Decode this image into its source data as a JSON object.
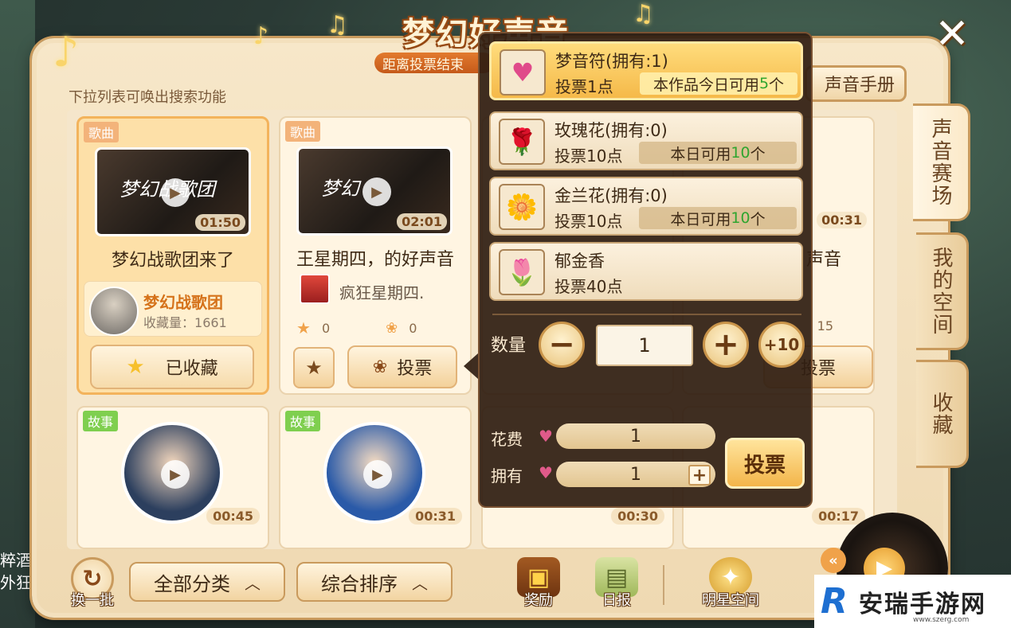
{
  "title": "梦幻好声音",
  "subtitle": "距离投票结束",
  "hint": "下拉列表可唤出搜索功能",
  "handbook_label": "声音手册",
  "close_label": "✕",
  "side_tabs": [
    "声音赛场",
    "我的空间",
    "收藏"
  ],
  "cards": [
    {
      "tag": "歌曲",
      "thumb_title": "梦幻战歌团",
      "thumb_title2": "声音",
      "duration": "01:50",
      "title": "梦幻战歌团来了",
      "author": "梦幻战歌团",
      "fav_label": "收藏量：",
      "fav_count": "1661",
      "collected_label": "已收藏"
    },
    {
      "tag": "歌曲",
      "thumb_title": "梦幻",
      "thumb_title2": "声音",
      "duration": "02:01",
      "title": "王星期四，的好声音",
      "author": "疯狂星期四.",
      "stars": "0",
      "flowers": "0",
      "vote_label": "投票"
    }
  ],
  "hidden_right": {
    "duration": "00:31",
    "title_part": "声音",
    "flowers": "15",
    "vote_label": "投票"
  },
  "story_cards": [
    {
      "tag": "故事",
      "duration": "00:45"
    },
    {
      "tag": "故事",
      "duration": "00:31"
    },
    {
      "tag": "故事",
      "duration": "00:30"
    },
    {
      "tag": "故事",
      "duration": "00:17"
    }
  ],
  "gifts": [
    {
      "name": "梦音符(拥有:1)",
      "cost": "投票1点",
      "avail_prefix": "本作品今日可用",
      "avail_num": "5",
      "avail_suffix": "个",
      "icon": "♥"
    },
    {
      "name": "玫瑰花(拥有:0)",
      "cost": "投票10点",
      "avail_prefix": "本日可用",
      "avail_num": "10",
      "avail_suffix": "个",
      "icon": "🌹"
    },
    {
      "name": "金兰花(拥有:0)",
      "cost": "投票10点",
      "avail_prefix": "本日可用",
      "avail_num": "10",
      "avail_suffix": "个",
      "icon": "🌼"
    },
    {
      "name": "郁金香",
      "cost": "投票40点",
      "icon": "🌷"
    }
  ],
  "quantity": {
    "label": "数量",
    "value": "1",
    "minus": "−",
    "plus": "+",
    "plus10": "+10"
  },
  "cost": {
    "label": "花费",
    "value": "1"
  },
  "owned": {
    "label": "拥有",
    "value": "1"
  },
  "vote_big_label": "投票",
  "bottom": {
    "refresh_label": "换一批",
    "category_label": "全部分类",
    "sort_label": "综合排序",
    "reward_label": "奖励",
    "daily_label": "日报",
    "star_space_label": "明星空间"
  },
  "left_bg_text": [
    "粹酒",
    "外狂"
  ],
  "watermark": {
    "logo": "R",
    "text": "安瑞手游网",
    "url": "www.szerg.com"
  },
  "colors": {
    "accent": "#f3b54a",
    "green": "#2fa52f",
    "brown": "#5a3a1e"
  }
}
